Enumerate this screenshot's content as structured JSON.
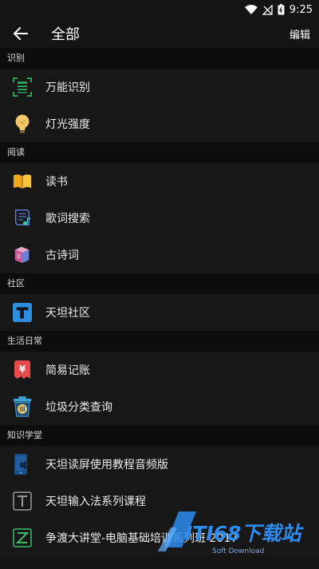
{
  "status": {
    "time": "9:25"
  },
  "appbar": {
    "title": "全部",
    "edit_label": "编辑"
  },
  "sections": [
    {
      "header": "识别",
      "items": [
        {
          "label": "万能识别",
          "icon": "scan-icon"
        },
        {
          "label": "灯光强度",
          "icon": "bulb-icon"
        }
      ]
    },
    {
      "header": "阅读",
      "items": [
        {
          "label": "读书",
          "icon": "book-icon"
        },
        {
          "label": "歌词搜索",
          "icon": "music-note-icon"
        },
        {
          "label": "古诗词",
          "icon": "books-stack-icon"
        }
      ]
    },
    {
      "header": "社区",
      "items": [
        {
          "label": "天坦社区",
          "icon": "t-logo-icon"
        }
      ]
    },
    {
      "header": "生活日常",
      "items": [
        {
          "label": "简易记账",
          "icon": "yen-tag-icon"
        },
        {
          "label": "垃圾分类查询",
          "icon": "trash-can-icon"
        }
      ]
    },
    {
      "header": "知识学堂",
      "items": [
        {
          "label": "天坦读屏使用教程音频版",
          "icon": "phone-audio-icon"
        },
        {
          "label": "天坦输入法系列课程",
          "icon": "t-box-icon"
        },
        {
          "label": "争渡大讲堂-电脑基础培训系列班 2017",
          "icon": "z-box-icon"
        }
      ]
    }
  ],
  "watermark": {
    "text": "ITI68下载站",
    "sub": "Soft Download"
  },
  "colors": {
    "background": "#141414",
    "section": "#0d0d0d",
    "row": "#171717",
    "accent": "#2d8cf0"
  }
}
